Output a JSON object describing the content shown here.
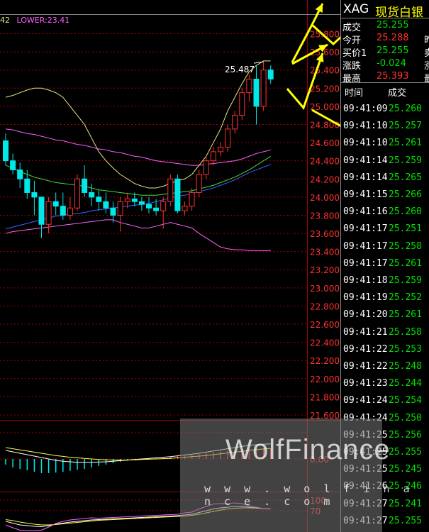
{
  "indicator": {
    "value_prefix": "42",
    "lower_label": "LOWER:23.41"
  },
  "annotation": {
    "peak_label": "25.487"
  },
  "colors": {
    "up": "#00e8e8",
    "down": "#ff3030",
    "upper": "#e8e880",
    "mid": "#ff60ff",
    "ma_white": "#e8e8e8",
    "ma_yellow": "#ffff40",
    "ma_green": "#40e040",
    "ma_blue": "#4060ff",
    "grid": "#a00000",
    "arrow": "#ffff00"
  },
  "chart_data": {
    "type": "candlestick",
    "symbol": "XAG",
    "y_ticks": [
      "25.800",
      "25.600",
      "25.400",
      "25.200",
      "25.000",
      "24.800",
      "24.600",
      "24.400",
      "24.200",
      "24.000",
      "23.800",
      "23.600",
      "23.400",
      "23.200",
      "23.000",
      "22.800",
      "22.600",
      "22.400",
      "22.200",
      "22.000",
      "21.800",
      "21.600"
    ],
    "ylim": [
      21.55,
      26.15
    ],
    "candles": [
      {
        "o": 24.62,
        "h": 24.7,
        "l": 24.35,
        "c": 24.4
      },
      {
        "o": 24.4,
        "h": 24.48,
        "l": 24.25,
        "c": 24.3
      },
      {
        "o": 24.3,
        "h": 24.38,
        "l": 24.1,
        "c": 24.2
      },
      {
        "o": 24.2,
        "h": 24.3,
        "l": 23.98,
        "c": 24.05
      },
      {
        "o": 24.05,
        "h": 24.18,
        "l": 23.8,
        "c": 24.0
      },
      {
        "o": 24.0,
        "h": 24.0,
        "l": 23.55,
        "c": 23.7
      },
      {
        "o": 23.7,
        "h": 24.0,
        "l": 23.6,
        "c": 23.95
      },
      {
        "o": 23.95,
        "h": 24.05,
        "l": 23.8,
        "c": 23.9
      },
      {
        "o": 23.9,
        "h": 24.05,
        "l": 23.75,
        "c": 23.8
      },
      {
        "o": 23.8,
        "h": 24.0,
        "l": 23.75,
        "c": 23.88
      },
      {
        "o": 23.88,
        "h": 24.25,
        "l": 23.85,
        "c": 24.2
      },
      {
        "o": 24.2,
        "h": 24.35,
        "l": 24.0,
        "c": 24.05
      },
      {
        "o": 24.05,
        "h": 24.15,
        "l": 23.9,
        "c": 24.0
      },
      {
        "o": 24.0,
        "h": 24.08,
        "l": 23.85,
        "c": 23.95
      },
      {
        "o": 23.95,
        "h": 24.05,
        "l": 23.82,
        "c": 23.88
      },
      {
        "o": 23.88,
        "h": 23.95,
        "l": 23.72,
        "c": 23.8
      },
      {
        "o": 23.8,
        "h": 24.0,
        "l": 23.62,
        "c": 23.95
      },
      {
        "o": 23.95,
        "h": 24.05,
        "l": 23.88,
        "c": 23.98
      },
      {
        "o": 23.98,
        "h": 24.05,
        "l": 23.9,
        "c": 23.95
      },
      {
        "o": 23.95,
        "h": 24.0,
        "l": 23.85,
        "c": 23.92
      },
      {
        "o": 23.92,
        "h": 24.0,
        "l": 23.82,
        "c": 23.88
      },
      {
        "o": 23.88,
        "h": 23.98,
        "l": 23.8,
        "c": 23.85
      },
      {
        "o": 23.85,
        "h": 24.0,
        "l": 23.65,
        "c": 23.95
      },
      {
        "o": 23.95,
        "h": 24.25,
        "l": 23.9,
        "c": 24.2
      },
      {
        "o": 24.2,
        "h": 24.25,
        "l": 23.82,
        "c": 23.85
      },
      {
        "o": 23.85,
        "h": 23.95,
        "l": 23.8,
        "c": 23.9
      },
      {
        "o": 23.9,
        "h": 24.1,
        "l": 23.85,
        "c": 24.05
      },
      {
        "o": 24.05,
        "h": 24.3,
        "l": 24.0,
        "c": 24.25
      },
      {
        "o": 24.25,
        "h": 24.45,
        "l": 24.2,
        "c": 24.4
      },
      {
        "o": 24.4,
        "h": 24.55,
        "l": 24.35,
        "c": 24.5
      },
      {
        "o": 24.5,
        "h": 24.6,
        "l": 24.45,
        "c": 24.55
      },
      {
        "o": 24.55,
        "h": 24.8,
        "l": 24.5,
        "c": 24.75
      },
      {
        "o": 24.75,
        "h": 24.95,
        "l": 24.7,
        "c": 24.9
      },
      {
        "o": 24.9,
        "h": 25.2,
        "l": 24.85,
        "c": 25.15
      },
      {
        "o": 25.15,
        "h": 25.35,
        "l": 25.05,
        "c": 25.3
      },
      {
        "o": 25.3,
        "h": 25.45,
        "l": 24.8,
        "c": 25.0
      },
      {
        "o": 25.0,
        "h": 25.49,
        "l": 24.95,
        "c": 25.4
      },
      {
        "o": 25.4,
        "h": 25.45,
        "l": 25.25,
        "c": 25.3
      }
    ],
    "upper_band": [
      25.1,
      25.12,
      25.15,
      25.18,
      25.2,
      25.2,
      25.18,
      25.15,
      25.1,
      25.0,
      24.9,
      24.8,
      24.65,
      24.5,
      24.4,
      24.32,
      24.25,
      24.2,
      24.15,
      24.12,
      24.1,
      24.1,
      24.12,
      24.15,
      24.18,
      24.2,
      24.25,
      24.35,
      24.45,
      24.6,
      24.75,
      24.95,
      25.1,
      25.25,
      25.38,
      25.45,
      25.5,
      25.5
    ],
    "mid_band": [
      24.75,
      24.74,
      24.72,
      24.7,
      24.69,
      24.67,
      24.65,
      24.63,
      24.62,
      24.6,
      24.58,
      24.57,
      24.55,
      24.53,
      24.52,
      24.5,
      24.49,
      24.47,
      24.45,
      24.44,
      24.42,
      24.4,
      24.39,
      24.38,
      24.37,
      24.36,
      24.35,
      24.35,
      24.36,
      24.37,
      24.38,
      24.39,
      24.4,
      24.42,
      24.45,
      24.48,
      24.5,
      24.52
    ],
    "lower_band": [
      23.6,
      23.62,
      23.63,
      23.64,
      23.65,
      23.66,
      23.67,
      23.68,
      23.69,
      23.7,
      23.71,
      23.72,
      23.73,
      23.74,
      23.75,
      23.75,
      23.72,
      23.7,
      23.68,
      23.66,
      23.66,
      23.68,
      23.7,
      23.72,
      23.7,
      23.68,
      23.66,
      23.6,
      23.55,
      23.5,
      23.45,
      23.43,
      23.42,
      23.42,
      23.41,
      23.41,
      23.41,
      23.41
    ],
    "ma_blue": [
      23.65,
      23.67,
      23.69,
      23.71,
      23.73,
      23.75,
      23.77,
      23.79,
      23.8,
      23.81,
      23.82,
      23.83,
      23.85,
      23.86,
      23.87,
      23.88,
      23.89,
      23.9,
      23.91,
      23.92,
      23.93,
      23.95,
      23.97,
      23.99,
      24.01,
      24.02,
      24.04,
      24.06,
      24.08,
      24.1,
      24.13,
      24.16,
      24.19,
      24.23,
      24.27,
      24.3,
      24.33,
      24.36
    ],
    "ma_green": [
      24.35,
      24.32,
      24.28,
      24.25,
      24.22,
      24.2,
      24.18,
      24.16,
      24.15,
      24.14,
      24.13,
      24.12,
      24.1,
      24.08,
      24.07,
      24.06,
      24.05,
      24.04,
      24.03,
      24.02,
      24.02,
      24.02,
      24.03,
      24.04,
      24.05,
      24.06,
      24.07,
      24.09,
      24.11,
      24.13,
      24.16,
      24.19,
      24.22,
      24.26,
      24.3,
      24.35,
      24.4,
      24.45
    ],
    "quote": {
      "title_code": "XAG",
      "title_name": "现货白银",
      "rows": [
        {
          "label": "成交",
          "value": "25.255",
          "value_color": "#00e000",
          "extra": ""
        },
        {
          "label": "今开",
          "value": "25.288",
          "value_color": "#ff3030",
          "extra": "昨"
        },
        {
          "label": "买价1",
          "value": "25.255",
          "value_color": "#00e000",
          "extra": "卖"
        },
        {
          "label": "涨跌",
          "value": "-0.024",
          "value_color": "#00e000",
          "extra": "涨"
        },
        {
          "label": "最高",
          "value": "25.393",
          "value_color": "#ff3030",
          "extra": "最"
        }
      ],
      "tick_header": {
        "time": "时间",
        "price": "成交"
      },
      "ticks": [
        {
          "time": "09:41:09",
          "price": "25.260"
        },
        {
          "time": "09:41:10",
          "price": "25.257"
        },
        {
          "time": "09:41:10",
          "price": "25.261"
        },
        {
          "time": "09:41:14",
          "price": "25.259"
        },
        {
          "time": "09:41:14",
          "price": "25.265"
        },
        {
          "time": "09:41:15",
          "price": "25.266"
        },
        {
          "time": "09:41:16",
          "price": "25.260"
        },
        {
          "time": "09:41:17",
          "price": "25.251"
        },
        {
          "time": "09:41:17",
          "price": "25.258"
        },
        {
          "time": "09:41:17",
          "price": "25.261"
        },
        {
          "time": "09:41:18",
          "price": "25.259"
        },
        {
          "time": "09:41:19",
          "price": "25.252"
        },
        {
          "time": "09:41:20",
          "price": "25.261"
        },
        {
          "time": "09:41:21",
          "price": "25.258"
        },
        {
          "time": "09:41:22",
          "price": "25.253"
        },
        {
          "time": "09:41:22",
          "price": "25.248"
        },
        {
          "time": "09:41:23",
          "price": "25.244"
        },
        {
          "time": "09:41:24",
          "price": "25.254"
        },
        {
          "time": "09:41:24",
          "price": "25.250"
        },
        {
          "time": "09:41:25",
          "price": "25.256"
        },
        {
          "time": "09:41:25",
          "price": "25.255"
        },
        {
          "time": "09:41:25",
          "price": "25.245"
        },
        {
          "time": "09:41:26",
          "price": "25.246"
        },
        {
          "time": "09:41:27",
          "price": "25.241"
        },
        {
          "time": "09:41:27",
          "price": "25.255"
        }
      ]
    },
    "macd": {
      "axis_label": "0.00",
      "hist": [
        -0.02,
        -0.03,
        -0.035,
        -0.04,
        -0.045,
        -0.05,
        -0.05,
        -0.048,
        -0.045,
        -0.042,
        -0.038,
        -0.035,
        -0.03,
        -0.025,
        -0.02,
        -0.015,
        -0.01,
        -0.006,
        -0.003,
        0,
        0.002,
        0.004,
        0.006,
        0.008,
        0.01,
        0.012,
        0.014,
        0.017,
        0.02,
        0.023,
        0.026,
        0.03,
        0.033,
        0.035,
        0.037,
        0.038,
        0.038,
        0.037
      ],
      "dif": [
        0.03,
        0.025,
        0.02,
        0.015,
        0.01,
        0.005,
        0.0,
        -0.005,
        -0.008,
        -0.01,
        -0.012,
        -0.012,
        -0.012,
        -0.011,
        -0.01,
        -0.008,
        -0.006,
        -0.004,
        -0.002,
        0,
        0.002,
        0.004,
        0.006,
        0.008,
        0.011,
        0.014,
        0.017,
        0.02,
        0.024,
        0.028,
        0.032,
        0.036,
        0.04,
        0.044,
        0.048,
        0.05,
        0.052,
        0.053
      ],
      "dea": [
        0.04,
        0.036,
        0.032,
        0.028,
        0.024,
        0.02,
        0.016,
        0.012,
        0.009,
        0.006,
        0.004,
        0.002,
        0.0,
        -0.002,
        -0.003,
        -0.004,
        -0.004,
        -0.004,
        -0.003,
        -0.002,
        -0.001,
        0,
        0.001,
        0.002,
        0.004,
        0.006,
        0.008,
        0.01,
        0.012,
        0.015,
        0.018,
        0.021,
        0.024,
        0.027,
        0.03,
        0.033,
        0.035,
        0.037
      ]
    },
    "kdj": {
      "ticks": [
        "100",
        "70"
      ],
      "k": [
        40,
        35,
        30,
        28,
        26,
        25,
        28,
        32,
        35,
        38,
        40,
        42,
        44,
        45,
        46,
        47,
        48,
        49,
        50,
        51,
        52,
        53,
        54,
        55,
        56,
        58,
        60,
        65,
        70,
        75,
        78,
        80,
        82,
        82,
        80,
        78,
        76,
        75
      ],
      "d": [
        45,
        42,
        38,
        35,
        32,
        30,
        30,
        31,
        33,
        35,
        37,
        39,
        41,
        43,
        44,
        45,
        46,
        47,
        48,
        49,
        50,
        51,
        52,
        53,
        54,
        55,
        57,
        60,
        64,
        68,
        72,
        75,
        77,
        78,
        78,
        77,
        76,
        75
      ],
      "j": [
        30,
        22,
        15,
        14,
        14,
        15,
        24,
        34,
        40,
        44,
        46,
        48,
        50,
        49,
        50,
        51,
        52,
        53,
        54,
        55,
        56,
        57,
        58,
        59,
        60,
        64,
        66,
        75,
        82,
        89,
        90,
        90,
        92,
        90,
        84,
        80,
        76,
        75
      ]
    }
  },
  "watermark": {
    "brand": "WolfFinance",
    "url": "w w w . w o l f i n a n c e . c o m"
  }
}
